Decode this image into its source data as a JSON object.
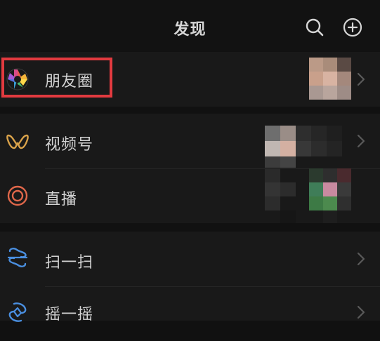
{
  "header": {
    "title": "发现",
    "search_icon": "search-icon",
    "add_icon": "plus-circle-icon"
  },
  "rows": [
    {
      "label": "朋友圈",
      "icon": "moments-aperture-icon",
      "highlighted": true
    },
    {
      "label": "视频号",
      "icon": "channels-icon"
    },
    {
      "label": "直播",
      "icon": "live-icon"
    },
    {
      "label": "扫一扫",
      "icon": "scan-icon"
    },
    {
      "label": "摇一摇",
      "icon": "shake-icon"
    }
  ],
  "colors": {
    "background": "#111111",
    "row_background": "#191919",
    "text": "#d2d2d2",
    "highlight_border": "#e23a3f",
    "channels_icon": "#d9a24a",
    "live_icon": "#e0674a",
    "scan_icon": "#4a8fe0"
  }
}
